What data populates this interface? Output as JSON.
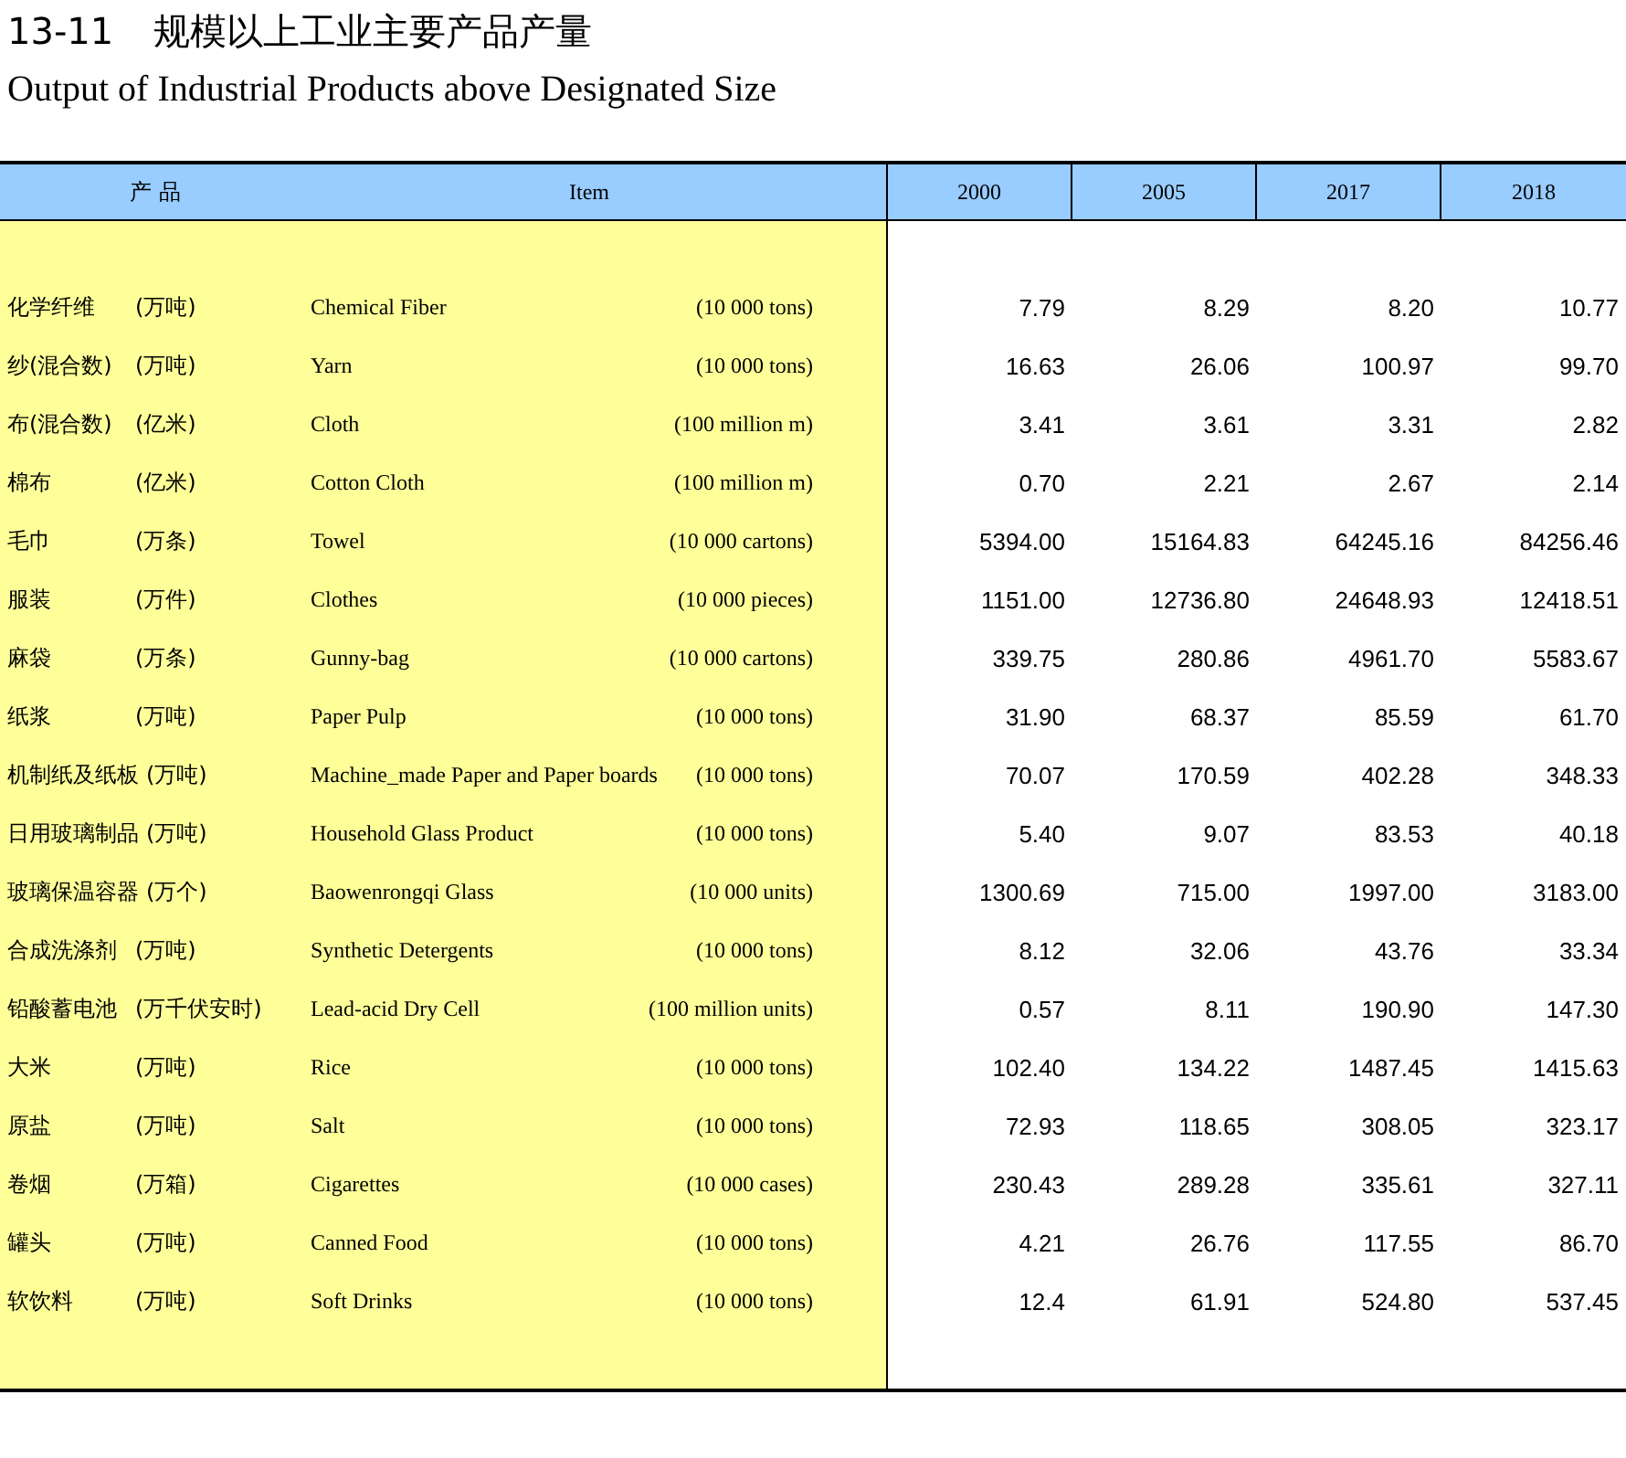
{
  "heading": {
    "number": "13-11",
    "title": "规模以上工业主要产品产量",
    "subtitle": "Output of Industrial Products above Designated Size"
  },
  "table": {
    "columns": [
      "产 品",
      "Item",
      "2000",
      "2005",
      "2017",
      "2018"
    ],
    "rows": [
      {
        "name_cn": "化学纤维",
        "unit_cn": "(万吨)",
        "name_en": "Chemical Fiber",
        "unit_en": "(10 000 tons)",
        "values": [
          "7.79",
          "8.29",
          "8.20",
          "10.77"
        ]
      },
      {
        "name_cn": "纱(混合数)",
        "unit_cn": "(万吨)",
        "name_en": "Yarn",
        "unit_en": "(10 000 tons)",
        "values": [
          "16.63",
          "26.06",
          "100.97",
          "99.70"
        ]
      },
      {
        "name_cn": "布(混合数)",
        "unit_cn": "(亿米)",
        "name_en": "Cloth",
        "unit_en": "(100 million m)",
        "values": [
          "3.41",
          "3.61",
          "3.31",
          "2.82"
        ]
      },
      {
        "name_cn": "棉布",
        "unit_cn": "(亿米)",
        "name_en": "Cotton Cloth",
        "unit_en": "(100 million m)",
        "values": [
          "0.70",
          "2.21",
          "2.67",
          "2.14"
        ]
      },
      {
        "name_cn": "毛巾",
        "unit_cn": "(万条)",
        "name_en": "Towel",
        "unit_en": "(10 000 cartons)",
        "values": [
          "5394.00",
          "15164.83",
          "64245.16",
          "84256.46"
        ]
      },
      {
        "name_cn": "服装",
        "unit_cn": "(万件)",
        "name_en": "Clothes",
        "unit_en": "(10 000 pieces)",
        "values": [
          "1151.00",
          "12736.80",
          "24648.93",
          "12418.51"
        ]
      },
      {
        "name_cn": "麻袋",
        "unit_cn": "(万条)",
        "name_en": "Gunny-bag",
        "unit_en": "(10 000 cartons)",
        "values": [
          "339.75",
          "280.86",
          "4961.70",
          "5583.67"
        ]
      },
      {
        "name_cn": "纸浆",
        "unit_cn": "(万吨)",
        "name_en": "Paper Pulp",
        "unit_en": "(10 000 tons)",
        "values": [
          "31.90",
          "68.37",
          "85.59",
          "61.70"
        ]
      },
      {
        "name_cn": "机制纸及纸板",
        "unit_cn": "(万吨)",
        "name_en": "Machine_made Paper and Paper boards",
        "unit_en": "(10 000 tons)",
        "values": [
          "70.07",
          "170.59",
          "402.28",
          "348.33"
        ]
      },
      {
        "name_cn": "日用玻璃制品",
        "unit_cn": "(万吨)",
        "name_en": "Household Glass Product",
        "unit_en": "(10 000 tons)",
        "values": [
          "5.40",
          "9.07",
          "83.53",
          "40.18"
        ]
      },
      {
        "name_cn": "玻璃保温容器",
        "unit_cn": "(万个)",
        "name_en": "Baowenrongqi Glass",
        "unit_en": "(10 000 units)",
        "values": [
          "1300.69",
          "715.00",
          "1997.00",
          "3183.00"
        ]
      },
      {
        "name_cn": "合成洗涤剂",
        "unit_cn": "(万吨)",
        "name_en": "Synthetic Detergents",
        "unit_en": "(10 000 tons)",
        "values": [
          "8.12",
          "32.06",
          "43.76",
          "33.34"
        ]
      },
      {
        "name_cn": "铅酸蓄电池",
        "unit_cn": "(万千伏安时)",
        "name_en": "Lead-acid Dry Cell",
        "unit_en": "(100 million units)",
        "values": [
          "0.57",
          "8.11",
          "190.90",
          "147.30"
        ]
      },
      {
        "name_cn": "大米",
        "unit_cn": "(万吨)",
        "name_en": "Rice",
        "unit_en": "(10 000 tons)",
        "values": [
          "102.40",
          "134.22",
          "1487.45",
          "1415.63"
        ]
      },
      {
        "name_cn": "原盐",
        "unit_cn": "(万吨)",
        "name_en": "Salt",
        "unit_en": "(10 000 tons)",
        "values": [
          "72.93",
          "118.65",
          "308.05",
          "323.17"
        ]
      },
      {
        "name_cn": "卷烟",
        "unit_cn": "(万箱)",
        "name_en": "Cigarettes",
        "unit_en": "(10 000 cases)",
        "values": [
          "230.43",
          "289.28",
          "335.61",
          "327.11"
        ]
      },
      {
        "name_cn": "罐头",
        "unit_cn": "(万吨)",
        "name_en": "Canned Food",
        "unit_en": "(10 000 tons)",
        "values": [
          "4.21",
          "26.76",
          "117.55",
          "86.70"
        ]
      },
      {
        "name_cn": "软饮料",
        "unit_cn": "(万吨)",
        "name_en": "Soft Drinks",
        "unit_en": "(10 000 tons)",
        "values": [
          "12.4",
          "61.91",
          "524.80",
          "537.45"
        ]
      }
    ]
  }
}
